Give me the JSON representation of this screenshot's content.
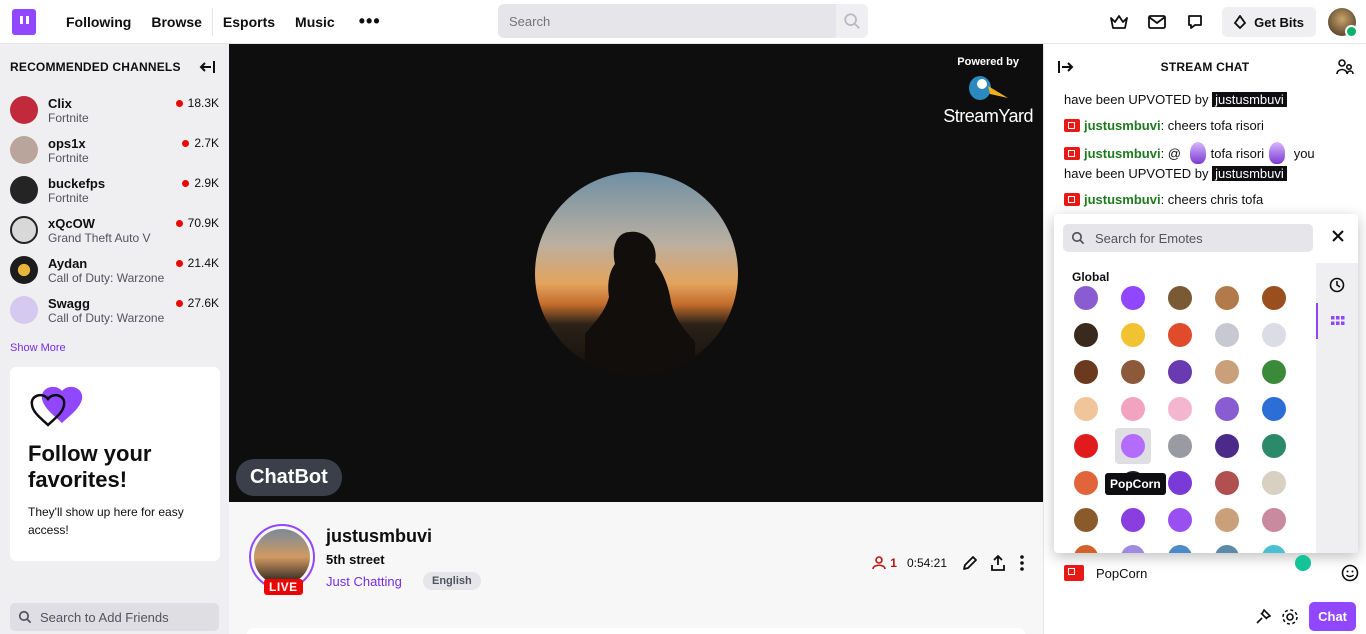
{
  "nav": {
    "links": [
      "Following",
      "Browse",
      "Esports",
      "Music"
    ],
    "more": "•••",
    "search_placeholder": "Search",
    "get_bits": "Get Bits"
  },
  "sidebar": {
    "title": "RECOMMENDED CHANNELS",
    "channels": [
      {
        "name": "Clix",
        "game": "Fortnite",
        "viewers": "18.3K",
        "color": "#c02a3a"
      },
      {
        "name": "ops1x",
        "game": "Fortnite",
        "viewers": "2.7K",
        "color": "#b9a59b"
      },
      {
        "name": "buckefps",
        "game": "Fortnite",
        "viewers": "2.9K",
        "color": "#242424"
      },
      {
        "name": "xQcOW",
        "game": "Grand Theft Auto V",
        "viewers": "70.9K",
        "color": "#d8d8d8"
      },
      {
        "name": "Aydan",
        "game": "Call of Duty: Warzone",
        "viewers": "21.4K",
        "color": "#1c1c1c"
      },
      {
        "name": "Swagg",
        "game": "Call of Duty: Warzone",
        "viewers": "27.6K",
        "color": "#d6c9f0"
      }
    ],
    "show_more": "Show More",
    "follow_title": "Follow your favorites!",
    "follow_sub": "They'll show up here for easy access!",
    "friends_search": "Search to Add Friends"
  },
  "video": {
    "powered_by": "Powered by",
    "brand": "StreamYard",
    "chatbot_label": "ChatBot"
  },
  "stream": {
    "live": "LIVE",
    "streamer": "justusmbuvi",
    "title": "5th street",
    "category": "Just Chatting",
    "tag": "English",
    "viewers": "1",
    "uptime": "0:54:21"
  },
  "chat": {
    "title": "STREAM CHAT",
    "messages": [
      {
        "pre": "have been UPVOTED by ",
        "hl": "justusmbuvi"
      },
      {
        "user": "justusmbuvi",
        "text": ": cheers tofa risori"
      },
      {
        "user": "justusmbuvi",
        "text": ": @ ",
        "mid": "tofa risori",
        "post": " you",
        "line2": "have been UPVOTED by ",
        "hl": "justusmbuvi"
      },
      {
        "user": "justusmbuvi",
        "text": ": cheers chris tofa"
      }
    ],
    "input_value": "PopCorn",
    "chat_button": "Chat"
  },
  "picker": {
    "search_placeholder": "Search for Emotes",
    "section": "Global",
    "tooltip": "PopCorn",
    "emotes": [
      {
        "name": "purple-box",
        "color": "#8a5cd1"
      },
      {
        "name": "twitch-glitch",
        "color": "#9147ff"
      },
      {
        "name": "wood-crate",
        "color": "#7a5a34"
      },
      {
        "name": "face-tan",
        "color": "#b27a4a"
      },
      {
        "name": "monkey",
        "color": "#9a4f1f"
      },
      {
        "name": "afro-face",
        "color": "#3a2a1e"
      },
      {
        "name": "gold-star",
        "color": "#f1c232"
      },
      {
        "name": "red-star",
        "color": "#e04b2c"
      },
      {
        "name": "foot-gray",
        "color": "#c8c8d2"
      },
      {
        "name": "foot-white",
        "color": "#dcdce6"
      },
      {
        "name": "football",
        "color": "#6b3a1e"
      },
      {
        "name": "drumstick",
        "color": "#8c5a3a"
      },
      {
        "name": "wizard-hat",
        "color": "#6a3ab0"
      },
      {
        "name": "face-old",
        "color": "#c9a07a"
      },
      {
        "name": "green-dragon",
        "color": "#3a8a3a"
      },
      {
        "name": "anime-girl",
        "color": "#f0c59a"
      },
      {
        "name": "pink-wings",
        "color": "#f2a3c0"
      },
      {
        "name": "pink-wings-2",
        "color": "#f4b5cf"
      },
      {
        "name": "party-hat",
        "color": "#8a5cd1"
      },
      {
        "name": "globe",
        "color": "#2b6fd6"
      },
      {
        "name": "raid",
        "color": "#e01b1b"
      },
      {
        "name": "popcorn",
        "color": "#b46bff"
      },
      {
        "name": "ref-face",
        "color": "#9a9aa2"
      },
      {
        "name": "purple-star",
        "color": "#4b2a8a"
      },
      {
        "name": "camera-flag",
        "color": "#2a8a6a"
      },
      {
        "name": "orange-feather",
        "color": "#e2643a"
      },
      {
        "name": "black-cat",
        "color": "#1e1e1e"
      },
      {
        "name": "purple-check",
        "color": "#7a3ad8"
      },
      {
        "name": "face-red-hat",
        "color": "#b05050"
      },
      {
        "name": "well-played",
        "color": "#d8d0c0"
      },
      {
        "name": "dwarf",
        "color": "#8a5a2a"
      },
      {
        "name": "purple-flame",
        "color": "#8b3ee0"
      },
      {
        "name": "purple-flame-2",
        "color": "#9a4ff0"
      },
      {
        "name": "thumbs-face",
        "color": "#c9a07a"
      },
      {
        "name": "bald-face",
        "color": "#c98aa0"
      },
      {
        "name": "orange-hand",
        "color": "#d4602a"
      },
      {
        "name": "purple-bow",
        "color": "#a08ae0"
      },
      {
        "name": "blue-fin",
        "color": "#4a8ac8"
      },
      {
        "name": "blue-face",
        "color": "#5a8aa8"
      },
      {
        "name": "teal-blob",
        "color": "#4ac0d0"
      }
    ]
  }
}
